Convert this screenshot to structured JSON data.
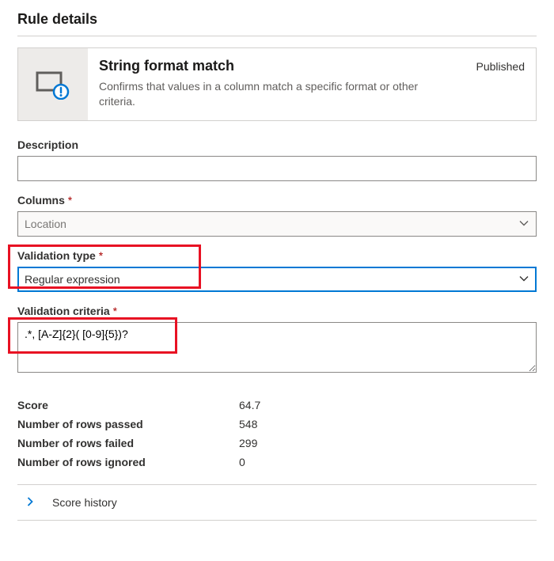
{
  "page": {
    "title": "Rule details"
  },
  "rule_card": {
    "title": "String format match",
    "description": "Confirms that values in a column match a specific format or other criteria.",
    "status": "Published"
  },
  "fields": {
    "description": {
      "label": "Description",
      "value": ""
    },
    "columns": {
      "label": "Columns",
      "value": "Location"
    },
    "validation_type": {
      "label": "Validation type",
      "value": "Regular expression"
    },
    "validation_criteria": {
      "label": "Validation criteria",
      "value": ".*, [A-Z]{2}( [0-9]{5})?"
    }
  },
  "stats": {
    "score": {
      "label": "Score",
      "value": "64.7"
    },
    "passed": {
      "label": "Number of rows passed",
      "value": "548"
    },
    "failed": {
      "label": "Number of rows failed",
      "value": "299"
    },
    "ignored": {
      "label": "Number of rows ignored",
      "value": "0"
    }
  },
  "expander": {
    "label": "Score history"
  }
}
